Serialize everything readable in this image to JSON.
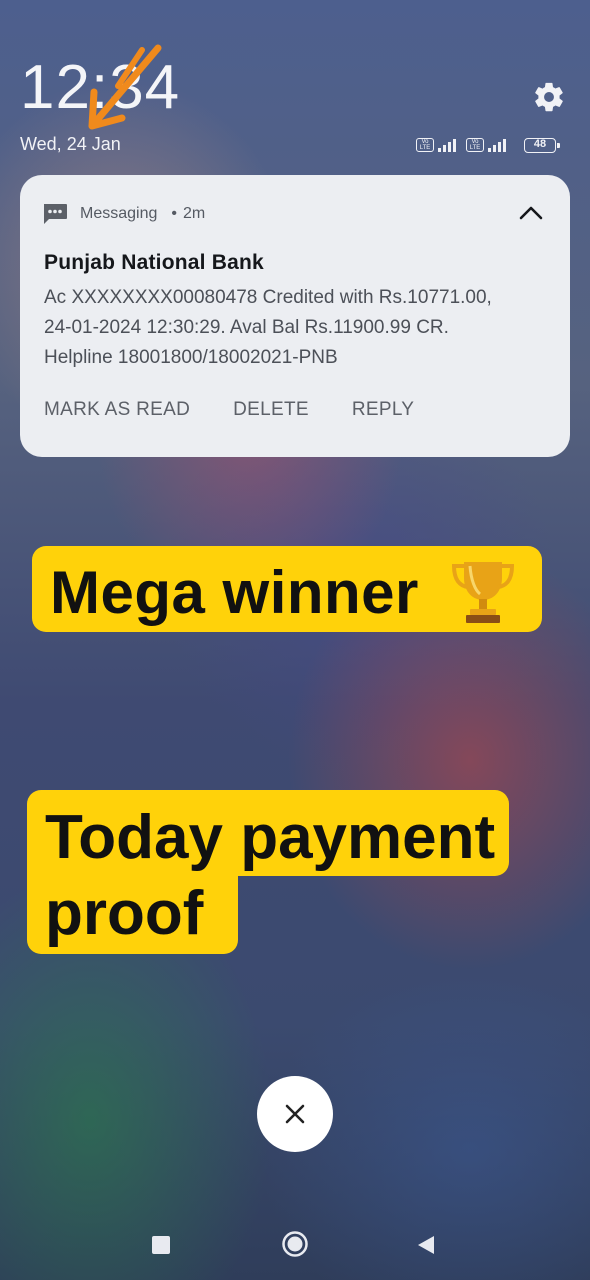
{
  "status_bar": {
    "time": "12:34",
    "date": "Wed, 24 Jan",
    "battery": "48",
    "volte_label": "Vo LTE"
  },
  "notification": {
    "app_name": "Messaging",
    "separator": "•",
    "age": "2m",
    "sender": "Punjab National Bank",
    "body": "Ac XXXXXXXX00080478 Credited with Rs.10771.00,\n24-01-2024 12:30:29. Aval Bal Rs.11900.99 CR.\nHelpline 18001800/18002021-PNB",
    "actions": [
      "MARK AS READ",
      "DELETE",
      "REPLY"
    ]
  },
  "overlay": {
    "banner1": "Mega winner",
    "banner2": "Today payment proof"
  },
  "colors": {
    "banner": "#ffd20a",
    "annotation_arrow": "#f08a1c",
    "card": "#eceef2"
  },
  "icons": {
    "settings": "gear-icon",
    "message": "message-icon",
    "collapse": "chevron-up-icon",
    "trophy": "trophy-icon",
    "close": "close-icon"
  }
}
